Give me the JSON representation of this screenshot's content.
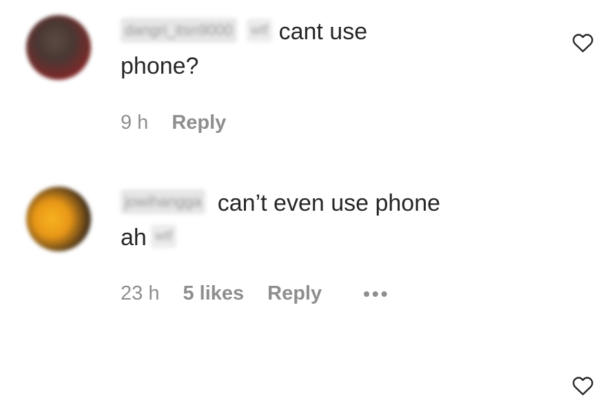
{
  "comments": [
    {
      "username": "dangri_itsn9000",
      "mention": "wtf",
      "text_before_break": "cant use",
      "text_after_break": "phone?",
      "time": "9 h",
      "reply_label": "Reply",
      "heart_icon": "heart-outline-icon"
    },
    {
      "username": "jowihangga",
      "text_before_break": "can’t even use phone",
      "text_after_break": "ah",
      "mention": "wtf",
      "time": "23 h",
      "likes": "5 likes",
      "reply_label": "Reply",
      "more_label": "•••",
      "heart_icon": "heart-outline-icon"
    }
  ]
}
